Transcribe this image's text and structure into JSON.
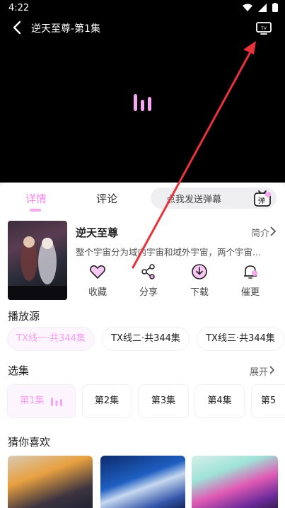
{
  "status": {
    "time": "4:22"
  },
  "player": {
    "title": "逆天至尊-第1集"
  },
  "tabs": {
    "detail": "详情",
    "comment": "评论"
  },
  "danmaku": {
    "placeholder": "点我发送弹幕",
    "button_label": "弹"
  },
  "show": {
    "title": "逆天至尊",
    "intro_label": "简介",
    "description": "整个宇宙分为域内宇宙和域外宇宙，两个宇宙..."
  },
  "actions": [
    {
      "label": "收藏",
      "icon": "heart-icon"
    },
    {
      "label": "分享",
      "icon": "share-icon"
    },
    {
      "label": "下载",
      "icon": "download-icon"
    },
    {
      "label": "催更",
      "icon": "bell-icon"
    }
  ],
  "sources": {
    "title": "播放源",
    "items": [
      "TX线一·共344集",
      "TX线二·共344集",
      "TX线三·共344集"
    ],
    "selected_index": 0
  },
  "episodes": {
    "title": "选集",
    "expand_label": "展开",
    "items": [
      "第1集",
      "第2集",
      "第3集",
      "第4集",
      "第5"
    ],
    "selected_index": 0
  },
  "recommend": {
    "title": "猜你喜欢"
  },
  "colors": {
    "accent": "#f089ea",
    "accent_light": "#f5a7f1",
    "arrow": "#e8323a"
  }
}
